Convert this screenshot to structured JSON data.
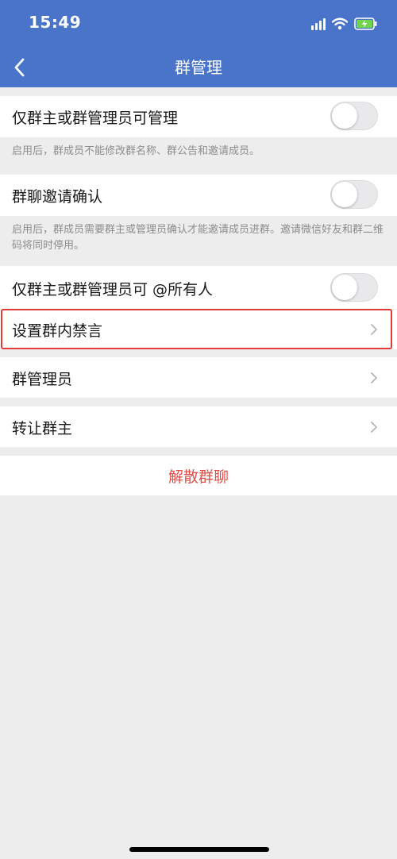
{
  "status_bar": {
    "time": "15:49"
  },
  "nav": {
    "title": "群管理"
  },
  "settings": {
    "admin_only_manage": {
      "label": "仅群主或群管理员可管理",
      "enabled": false,
      "description": "启用后，群成员不能修改群名称、群公告和邀请成员。"
    },
    "invite_confirm": {
      "label": "群聊邀请确认",
      "enabled": false,
      "description": "启用后，群成员需要群主或管理员确认才能邀请成员进群。邀请微信好友和群二维码将同时停用。"
    },
    "at_all": {
      "label": "仅群主或群管理员可 @所有人",
      "enabled": false
    },
    "mute": {
      "label": "设置群内禁言"
    },
    "admins": {
      "label": "群管理员"
    },
    "transfer": {
      "label": "转让群主"
    },
    "dissolve": {
      "label": "解散群聊"
    }
  },
  "colors": {
    "header": "#4a74c9",
    "background": "#ededed",
    "danger": "#e0504a",
    "highlight": "#e53935"
  },
  "icons": [
    "signal-icon",
    "wifi-icon",
    "battery-charging-icon",
    "back-chevron-icon",
    "chevron-right-icon"
  ]
}
